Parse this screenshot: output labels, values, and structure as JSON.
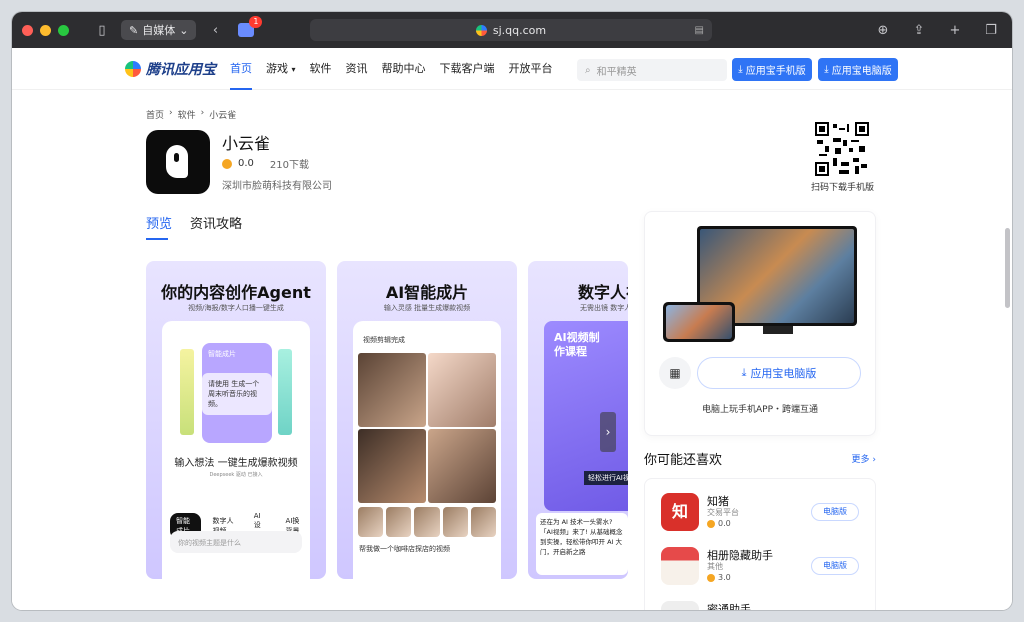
{
  "browser": {
    "profile_label": "自媒体",
    "tab_badge": "1",
    "url": "sj.qq.com"
  },
  "nav": {
    "logo_text": "腾讯应用宝",
    "items": [
      "首页",
      "游戏",
      "软件",
      "资讯",
      "帮助中心",
      "下载客户端",
      "开放平台"
    ],
    "search_placeholder": "和平精英",
    "mobile_btn": "应用宝手机版",
    "pc_btn": "应用宝电脑版"
  },
  "breadcrumb": [
    "首页",
    "›",
    "软件",
    "›",
    "小云雀"
  ],
  "app": {
    "name": "小云雀",
    "rating": "0.0",
    "downloads": "210下载",
    "developer": "深圳市脸萌科技有限公司",
    "qr_label": "扫码下载手机版"
  },
  "tabs": [
    "预览",
    "资讯攻略"
  ],
  "screenshots": [
    {
      "title": "你的内容创作Agent",
      "subtitle": "视频/海报/数字人口播一键生成",
      "card_label": "智能成片",
      "bubble": "请使用 生成一个周末听音乐的视频。",
      "main_text": "输入想法 一键生成爆款视频",
      "footer_note": "Deepseek 驱动 已接入",
      "chips": [
        "智能成片",
        "数字人视频",
        "AI设计",
        "AI换背景"
      ],
      "input_placeholder": "你的视频主题是什么"
    },
    {
      "title": "AI智能成片",
      "subtitle": "输入灵感 批量生成爆款视频",
      "card_label": "视频剪辑完成",
      "caption": "帮我做一个咖啡店探店的视频"
    },
    {
      "title": "数字人视",
      "subtitle": "无需出镜 数字人",
      "tag": "AI视频制作课程",
      "badge": "轻松进行AI视",
      "text": "还在为 AI 技术一头雾水? 「AI视频」来了! 从基础概念到实操，轻松带你叩开 AI 大门，开启新之路"
    }
  ],
  "side": {
    "pc_btn": "应用宝电脑版",
    "caption": "电脑上玩手机APP・跨端互通"
  },
  "likes": {
    "title": "你可能还喜欢",
    "more": "更多",
    "items": [
      {
        "name": "知猪",
        "category": "交易平台",
        "rating": "0.0",
        "btn": "电脑版",
        "color": "#d9302a"
      },
      {
        "name": "相册隐藏助手",
        "category": "其他",
        "rating": "3.0",
        "btn": "电脑版",
        "color": "#e64a4a"
      },
      {
        "name": "密通助手",
        "category": "",
        "rating": "",
        "btn": "",
        "color": "#eeeeee"
      }
    ]
  }
}
